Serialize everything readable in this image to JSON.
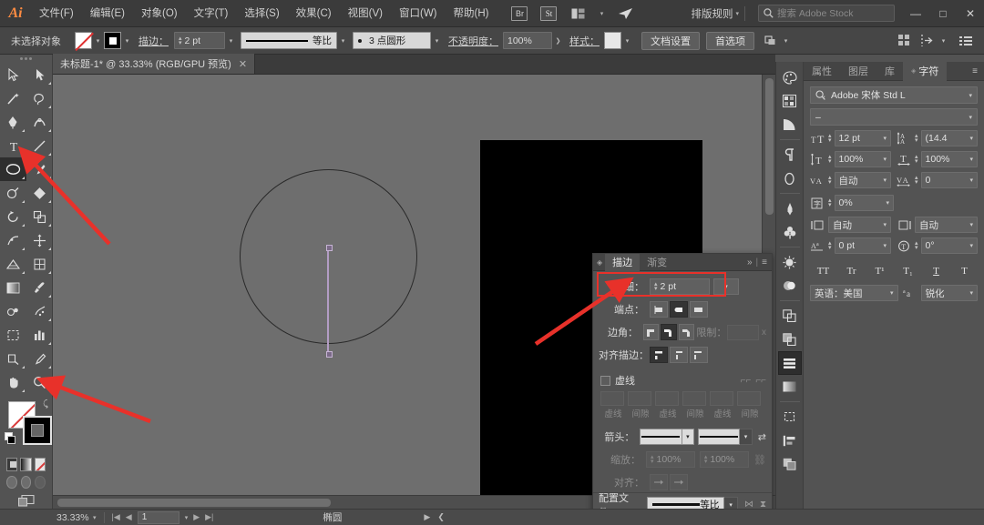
{
  "app": {
    "name": "Adobe Illustrator",
    "logo": "Ai"
  },
  "menubar": {
    "items": [
      {
        "label": "文件(F)",
        "name": "menu-file"
      },
      {
        "label": "编辑(E)",
        "name": "menu-edit"
      },
      {
        "label": "对象(O)",
        "name": "menu-object"
      },
      {
        "label": "文字(T)",
        "name": "menu-type"
      },
      {
        "label": "选择(S)",
        "name": "menu-select"
      },
      {
        "label": "效果(C)",
        "name": "menu-effect"
      },
      {
        "label": "视图(V)",
        "name": "menu-view"
      },
      {
        "label": "窗口(W)",
        "name": "menu-window"
      },
      {
        "label": "帮助(H)",
        "name": "menu-help"
      }
    ],
    "bridge_label": "Br",
    "stock_label": "St",
    "arrange_label": "排版规则",
    "search_placeholder": "搜索 Adobe Stock",
    "window_buttons": {
      "minimize": "—",
      "maximize": "□",
      "close": "✕"
    }
  },
  "controlbar": {
    "selection_status": "未选择对象",
    "fill_label": "fill-swatch",
    "stroke_label": "描边：",
    "stroke_weight": "2 pt",
    "stroke_profile": "等比",
    "brush_definition": "3 点圆形",
    "opacity_label": "不透明度：",
    "opacity_value": "100%",
    "style_label": "样式：",
    "document_setup": "文档设置",
    "preferences": "首选项"
  },
  "document_tab": {
    "title": "未标题-1* @ 33.33% (RGB/GPU 预览)",
    "close": "✕"
  },
  "toolbar": {
    "tools": [
      {
        "name": "selection-tool",
        "label": "选择工具"
      },
      {
        "name": "direct-selection-tool",
        "label": "直接选择工具"
      },
      {
        "name": "magic-wand-tool",
        "label": "魔棒工具"
      },
      {
        "name": "lasso-tool",
        "label": "套索工具"
      },
      {
        "name": "pen-tool",
        "label": "钢笔工具"
      },
      {
        "name": "curvature-tool",
        "label": "曲率工具"
      },
      {
        "name": "type-tool",
        "label": "文字工具"
      },
      {
        "name": "line-segment-tool",
        "label": "直线段工具"
      },
      {
        "name": "ellipse-tool",
        "label": "椭圆工具",
        "active": true
      },
      {
        "name": "paintbrush-tool",
        "label": "画笔工具"
      },
      {
        "name": "shaper-tool",
        "label": "Shaper 工具"
      },
      {
        "name": "shape-builder-tool",
        "label": "形状生成器工具"
      },
      {
        "name": "rotate-tool",
        "label": "旋转工具"
      },
      {
        "name": "scale-tool",
        "label": "比例缩放工具"
      },
      {
        "name": "width-tool",
        "label": "宽度工具"
      },
      {
        "name": "free-transform-tool",
        "label": "自由变换工具"
      },
      {
        "name": "perspective-grid-tool",
        "label": "透视网格工具"
      },
      {
        "name": "mesh-tool",
        "label": "网格工具"
      },
      {
        "name": "gradient-tool",
        "label": "渐变工具"
      },
      {
        "name": "eyedropper-tool",
        "label": "吸管工具"
      },
      {
        "name": "blend-tool",
        "label": "混合工具"
      },
      {
        "name": "symbol-sprayer-tool",
        "label": "符号喷枪工具"
      },
      {
        "name": "column-graph-tool",
        "label": "柱形图工具"
      },
      {
        "name": "artboard-tool",
        "label": "画板工具"
      },
      {
        "name": "slice-tool",
        "label": "切片工具"
      },
      {
        "name": "hand-tool",
        "label": "抓手工具"
      },
      {
        "name": "zoom-tool",
        "label": "缩放工具"
      }
    ],
    "fill_color": "#ffffff",
    "stroke_color": "#000000",
    "swap_icon": "swap-fill-stroke-icon",
    "modes": [
      "color-mode",
      "gradient-mode",
      "none-mode"
    ],
    "draw_modes": [
      "draw-normal",
      "draw-behind",
      "draw-inside"
    ],
    "screen_mode": "change-screen-mode"
  },
  "canvas": {
    "background": "#6e6e6e",
    "artboard_color": "#000000",
    "ellipse_stroke": "#2a2a2a",
    "line_color": "#b39cc4"
  },
  "stroke_panel": {
    "tabs": [
      {
        "label": "描边",
        "selected": true
      },
      {
        "label": "渐变",
        "selected": false
      }
    ],
    "collapse_icon": "»",
    "menu_icon": "≡",
    "weight_label": "粗细：",
    "weight_value": "2 pt",
    "cap_label": "端点：",
    "corner_label": "边角：",
    "limit_label": "限制：",
    "limit_value": "",
    "limit_unit": "x",
    "align_label": "对齐描边：",
    "dashed_label": "虚线",
    "dash_columns": [
      "虚线",
      "间隙",
      "虚线",
      "间隙",
      "虚线",
      "间隙"
    ],
    "arrowheads_label": "箭头：",
    "scale_label": "缩放：",
    "scale_value_1": "100%",
    "scale_value_2": "100%",
    "align_arrow_label": "对齐：",
    "profile_label": "配置文件：",
    "profile_value": "等比",
    "highlight_color": "#e8312a"
  },
  "right_panel": {
    "tabs": [
      {
        "label": "属性",
        "selected": false
      },
      {
        "label": "图层",
        "selected": false
      },
      {
        "label": "库",
        "selected": false
      },
      {
        "label": "字符",
        "selected": true
      }
    ],
    "menu_icon": "≡",
    "font_family": "Adobe 宋体 Std L",
    "font_style": "–",
    "font_size": "12 pt",
    "leading": "(14.4 ",
    "vertical_scale": "100%",
    "horizontal_scale": "100%",
    "kerning": "自动",
    "tracking": "0",
    "baseline_pct": "0%",
    "left_aki": "自动",
    "right_aki": "自动",
    "baseline_shift": "0 pt",
    "rotation": "0°",
    "style_buttons": [
      "TT",
      "Tr",
      "T¹",
      "T₁",
      "T",
      "T"
    ],
    "language": "英语：美国",
    "anti_alias": "锐化"
  },
  "dock_icons": [
    {
      "name": "color-panel-icon"
    },
    {
      "name": "color-guide-icon"
    },
    {
      "name": "color-themes-icon"
    },
    {
      "name": "paragraph-panel-icon"
    },
    {
      "name": "glyphs-panel-icon"
    },
    {
      "name": "brushes-panel-icon"
    },
    {
      "name": "symbols-panel-icon"
    },
    {
      "name": "appearance-panel-icon"
    },
    {
      "name": "graphic-styles-icon"
    },
    {
      "name": "transform-panel-icon"
    },
    {
      "name": "pathfinder-panel-icon"
    },
    {
      "name": "align-panel-icon",
      "active": true
    },
    {
      "name": "gradient-panel-icon"
    },
    {
      "name": "transparency-panel-icon"
    },
    {
      "name": "artboards-panel-icon"
    },
    {
      "name": "asset-export-icon"
    }
  ],
  "statusbar": {
    "zoom_value": "33.33%",
    "page_value": "1",
    "tool_name": "椭圆",
    "first_icon": "|◀",
    "prev_icon": "◀",
    "next_icon": "▶",
    "last_icon": "▶|"
  }
}
